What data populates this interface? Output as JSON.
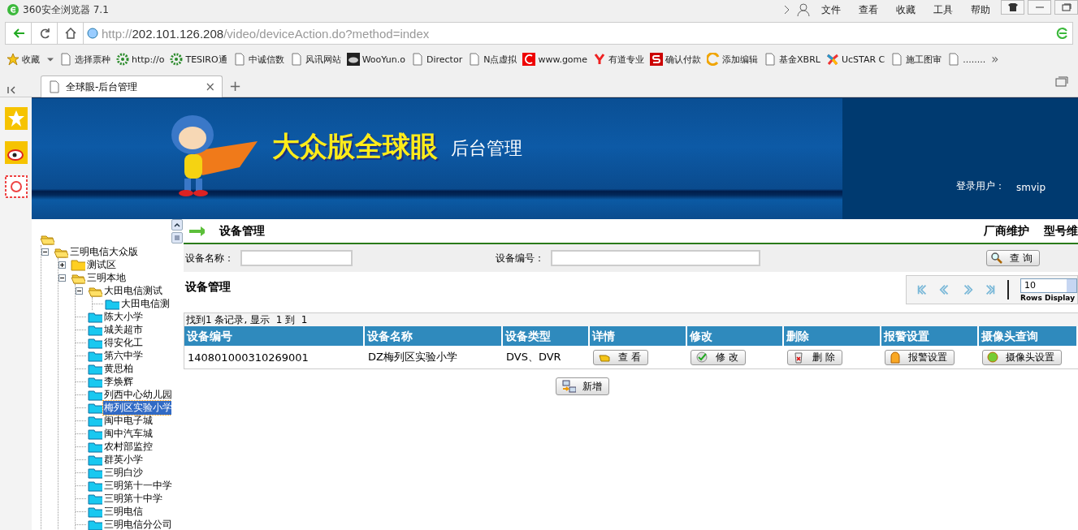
{
  "browser": {
    "title": "360安全浏览器 7.1",
    "menu": [
      "文件",
      "查看",
      "收藏",
      "工具",
      "帮助"
    ],
    "url": {
      "scheme": "http://",
      "host": "202.101.126.208",
      "path": "/video/deviceAction.do?method=index"
    },
    "bookmarks": [
      {
        "label": "收藏",
        "kind": "favorites"
      },
      {
        "label": "选择票种",
        "kind": "page"
      },
      {
        "label": "http://o",
        "kind": "gear"
      },
      {
        "label": "TESIRO通",
        "kind": "gear"
      },
      {
        "label": "中诚信数",
        "kind": "page"
      },
      {
        "label": "风讯网站",
        "kind": "page"
      },
      {
        "label": "WooYun.o",
        "kind": "cloud"
      },
      {
        "label": "Director",
        "kind": "page"
      },
      {
        "label": "N点虚拟",
        "kind": "page"
      },
      {
        "label": "www.gome",
        "kind": "red"
      },
      {
        "label": "有道专业",
        "kind": "y"
      },
      {
        "label": "确认付款",
        "kind": "s"
      },
      {
        "label": "添加编辑",
        "kind": "swirl"
      },
      {
        "label": "基金XBRL",
        "kind": "page"
      },
      {
        "label": "UcSTAR C",
        "kind": "star"
      },
      {
        "label": "施工图审",
        "kind": "page"
      },
      {
        "label": "........",
        "kind": "page"
      }
    ],
    "more": "»",
    "tabs": [
      {
        "label": "全球眼-后台管理",
        "selected": true
      }
    ],
    "close": "×",
    "new_tab": "+"
  },
  "banner": {
    "title": "大众版全球眼",
    "subtitle": "后台管理",
    "user_label": "登录用户：",
    "user": "smvip"
  },
  "tree": {
    "children": [
      {
        "label": "三明电信大众版",
        "kind": "group",
        "expanded": true,
        "selected": false,
        "children": [
          {
            "label": "测试区",
            "kind": "group",
            "expanded": false,
            "selected": false
          },
          {
            "label": "三明本地",
            "kind": "group",
            "expanded": true,
            "selected": false,
            "children": [
              {
                "label": "大田电信测试",
                "kind": "group",
                "expanded": true,
                "selected": false,
                "children": [
                  {
                    "label": "大田电信测",
                    "kind": "device",
                    "selected": false
                  }
                ]
              },
              {
                "label": "陈大小学",
                "kind": "device",
                "selected": false
              },
              {
                "label": "城关超市",
                "kind": "device",
                "selected": false
              },
              {
                "label": "得安化工",
                "kind": "device",
                "selected": false
              },
              {
                "label": "第六中学",
                "kind": "device",
                "selected": false
              },
              {
                "label": "黄思柏",
                "kind": "device",
                "selected": false
              },
              {
                "label": "李焕辉",
                "kind": "device",
                "selected": false
              },
              {
                "label": "列西中心幼儿园",
                "kind": "device",
                "selected": false
              },
              {
                "label": "梅列区实验小学",
                "kind": "device",
                "selected": true
              },
              {
                "label": "闽中电子城",
                "kind": "device",
                "selected": false
              },
              {
                "label": "闽中汽车城",
                "kind": "device",
                "selected": false
              },
              {
                "label": "农村部监控",
                "kind": "device",
                "selected": false
              },
              {
                "label": "群英小学",
                "kind": "device",
                "selected": false
              },
              {
                "label": "三明白沙",
                "kind": "device",
                "selected": false
              },
              {
                "label": "三明第十一中学",
                "kind": "device",
                "selected": false
              },
              {
                "label": "三明第十中学",
                "kind": "device",
                "selected": false
              },
              {
                "label": "三明电信",
                "kind": "device",
                "selected": false
              },
              {
                "label": "三明电信分公司",
                "kind": "device",
                "selected": false
              }
            ]
          }
        ]
      }
    ]
  },
  "main": {
    "heading": "设备管理",
    "links": [
      "厂商维护",
      "型号维"
    ],
    "search": {
      "fields": [
        {
          "label": "设备名称："
        },
        {
          "label": "设备编号："
        }
      ],
      "button": "查 询"
    },
    "list_title": "设备管理",
    "pager": {
      "rows": "10",
      "rows_label": "Rows Display"
    },
    "summary": "找到1 条记录, 显示  1 到  1",
    "table": {
      "columns": [
        "设备编号",
        "设备名称",
        "设备类型",
        "详情",
        "修改",
        "删除",
        "报警设置",
        "摄像头查询"
      ],
      "rows": [
        {
          "cells": [
            "140801000310269001",
            "DZ梅列区实验小学",
            "DVS、DVR"
          ],
          "actions": [
            {
              "kind": "view",
              "label": "查 看"
            },
            {
              "kind": "edit",
              "label": "修 改"
            },
            {
              "kind": "delete",
              "label": "删 除"
            },
            {
              "kind": "alarm",
              "label": "报警设置"
            },
            {
              "kind": "camera",
              "label": "摄像头设置"
            }
          ]
        }
      ]
    },
    "add_button": "新增"
  }
}
